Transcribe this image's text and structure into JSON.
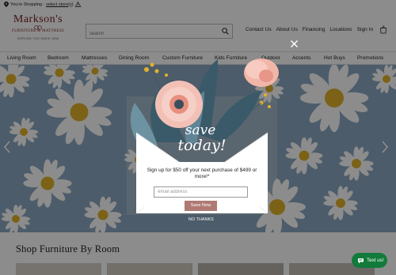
{
  "topbar": {
    "shopping_prefix": "You're Shopping :",
    "store_link": "select store(s)"
  },
  "brand": {
    "name": "Markson's",
    "subtitle": "FURNITURE & MATTRESS",
    "tagline": "SERVING YOU SINCE 1955",
    "color": "#7a1a1f"
  },
  "search": {
    "placeholder": "search"
  },
  "header_nav": [
    {
      "label": "Contact Us"
    },
    {
      "label": "About Us"
    },
    {
      "label": "Financing"
    },
    {
      "label": "Locations"
    },
    {
      "label": "Sign In"
    }
  ],
  "cart": {
    "count": "0"
  },
  "category_nav": [
    {
      "label": "Living Room"
    },
    {
      "label": "Bedroom"
    },
    {
      "label": "Mattresses"
    },
    {
      "label": "Dining Room"
    },
    {
      "label": "Custom Furniture"
    },
    {
      "label": "Kids Furniture"
    },
    {
      "label": "Outdoor"
    },
    {
      "label": "Accents"
    },
    {
      "label": "Hot Buys"
    },
    {
      "label": "Promotions"
    }
  ],
  "section": {
    "title": "Shop Furniture By Room"
  },
  "popup": {
    "headline_line1": "save",
    "headline_line2": "today!",
    "message": "Sign up for $50 off your next purchase of $499 or more!*",
    "email_placeholder": "email address",
    "submit_label": "Save Now",
    "dismiss_label": "NO THANKS"
  },
  "chat": {
    "label": "Text us!"
  },
  "colors": {
    "accent_button": "#b07a74",
    "chat_green": "#127a3a",
    "hero_sky": "#8da8c2",
    "envelope": "#ffffff"
  }
}
